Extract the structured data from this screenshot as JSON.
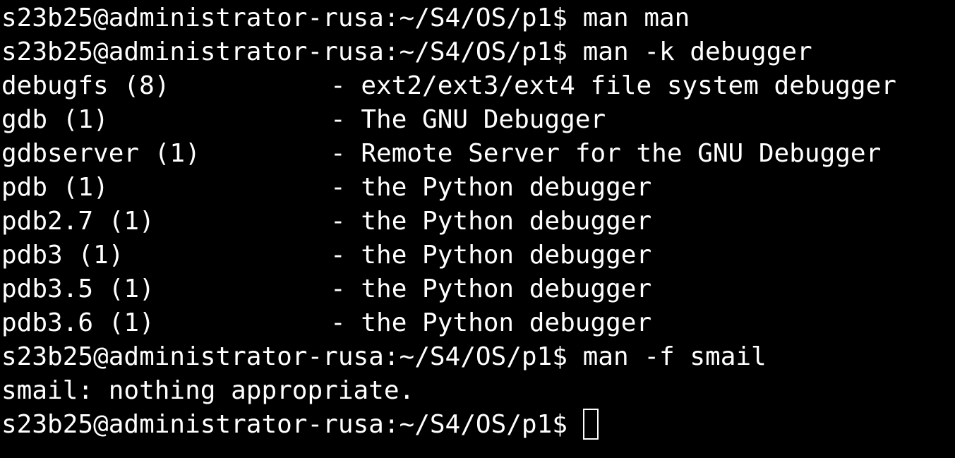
{
  "terminal": {
    "colors": {
      "background": "#000000",
      "foreground": "#ffffff"
    },
    "prompt": "s23b25@administrator-rusa:~/S4/OS/p1$",
    "commands": [
      "man man",
      "man -k debugger",
      "man -f smail"
    ],
    "apropos_results": [
      {
        "name": "debugfs (8)",
        "description": "- ext2/ext3/ext4 file system debugger"
      },
      {
        "name": "gdb (1)",
        "description": "- The GNU Debugger"
      },
      {
        "name": "gdbserver (1)",
        "description": "- Remote Server for the GNU Debugger"
      },
      {
        "name": "pdb (1)",
        "description": "- the Python debugger"
      },
      {
        "name": "pdb2.7 (1)",
        "description": "- the Python debugger"
      },
      {
        "name": "pdb3 (1)",
        "description": "- the Python debugger"
      },
      {
        "name": "pdb3.5 (1)",
        "description": "- the Python debugger"
      },
      {
        "name": "pdb3.6 (1)",
        "description": "- the Python debugger"
      }
    ],
    "whatis_output": "smail: nothing appropriate.",
    "cursor_icon": "block-cursor"
  }
}
